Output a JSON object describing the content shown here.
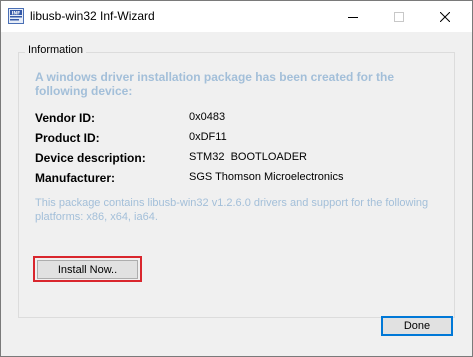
{
  "window": {
    "title": "libusb-win32 Inf-Wizard",
    "icon": "inf-file-icon"
  },
  "titlebar_buttons": [
    "minimize-icon",
    "maximize-icon",
    "close-icon"
  ],
  "group": {
    "label": "Information",
    "headline": "A windows driver installation package has been created for the following device:",
    "fields": [
      {
        "label": "Vendor ID:",
        "value": "0x0483"
      },
      {
        "label": "Product ID:",
        "value": "0xDF11"
      },
      {
        "label": "Device description:",
        "value": "STM32  BOOTLOADER"
      },
      {
        "label": "Manufacturer:",
        "value": "SGS Thomson Microelectronics"
      }
    ],
    "note": "This package contains libusb-win32 v1.2.6.0 drivers and support for the following platforms: x86, x64, ia64."
  },
  "buttons": {
    "install_label": "Install Now..",
    "done_label": "Done"
  },
  "colors": {
    "highlight": "#d9262d",
    "info_text": "#a3bfd9",
    "focus_border": "#0078d7"
  }
}
